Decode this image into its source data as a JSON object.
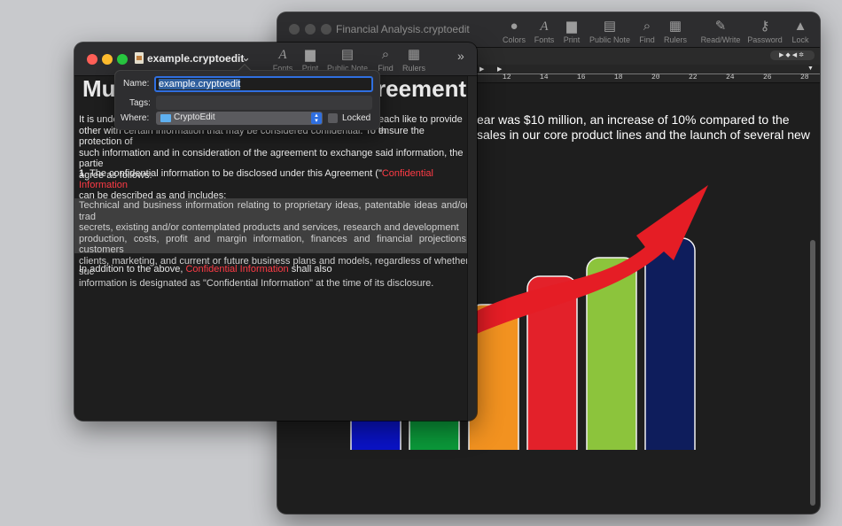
{
  "back_window": {
    "title": "Financial Analysis.cryptoedit",
    "toolbar": [
      {
        "icon": "colors-icon",
        "label": "Colors"
      },
      {
        "icon": "fonts-icon",
        "label": "Fonts"
      },
      {
        "icon": "print-icon",
        "label": "Print"
      },
      {
        "icon": "public-note-icon",
        "label": "Public Note"
      },
      {
        "icon": "find-icon",
        "label": "Find"
      },
      {
        "icon": "rulers-icon",
        "label": "Rulers"
      },
      {
        "icon": "read-write-icon",
        "label": "Read/Write"
      },
      {
        "icon": "password-icon",
        "label": "Password"
      },
      {
        "icon": "lock-icon",
        "label": "Lock"
      }
    ],
    "ruler_ticks": [
      "12",
      "14",
      "16",
      "18",
      "20",
      "22",
      "24",
      "26",
      "28"
    ],
    "body_line1": "ear was $10 million, an increase of 10% compared to the",
    "body_line2": "sales in our core product lines and the launch of several new",
    "chart_bars": [
      {
        "color": "#0a13c8"
      },
      {
        "color": "#0b9a3a"
      },
      {
        "color": "#f29220"
      },
      {
        "color": "#e3212a"
      },
      {
        "color": "#8cc43c"
      },
      {
        "color": "#0e1d5c"
      }
    ],
    "arrow_color": "#e51d25"
  },
  "front_window": {
    "title": "example.cryptoedit",
    "toolbar_labels": [
      "Fonts",
      "Print",
      "Public Note",
      "Find",
      "Rulers"
    ],
    "heading_left": "Mu",
    "heading_right": "reement",
    "para1": [
      "It is unde",
      "each like to provide th",
      "other with certain information that may be considered confidential. To ensure the protection of",
      "such information and in consideration of the agreement to exchange said information, the partie",
      "agree as follows:"
    ],
    "item_number": "1",
    "item_text": ". The confidential information to be disclosed under this Agreement (\"",
    "item_link": "Confidential Information",
    "item_text2": "can be described as and includes:",
    "highlight_lines": [
      "Technical and business information relating to proprietary ideas, patentable ideas and/or trad",
      "secrets, existing and/or contemplated products and services, research and development",
      "production, costs, profit and margin information, finances and financial projections, customers",
      "clients, marketing, and current or future business plans and models, regardless of whether suc",
      "information is designated as \"Confidential Information\" at the time of its disclosure."
    ],
    "para3_start": "In addition to the above, ",
    "para3_link": "Confidential Information",
    "para3_end": " shall also"
  },
  "popover": {
    "name_label": "Name:",
    "name_value": "example.cryptoedit",
    "tags_label": "Tags:",
    "tags_value": "",
    "where_label": "Where:",
    "where_value": "CryptoEdit",
    "locked_label": "Locked"
  },
  "colors": {
    "link_red": "#ff3b45",
    "accent_blue": "#2f6fe0"
  }
}
